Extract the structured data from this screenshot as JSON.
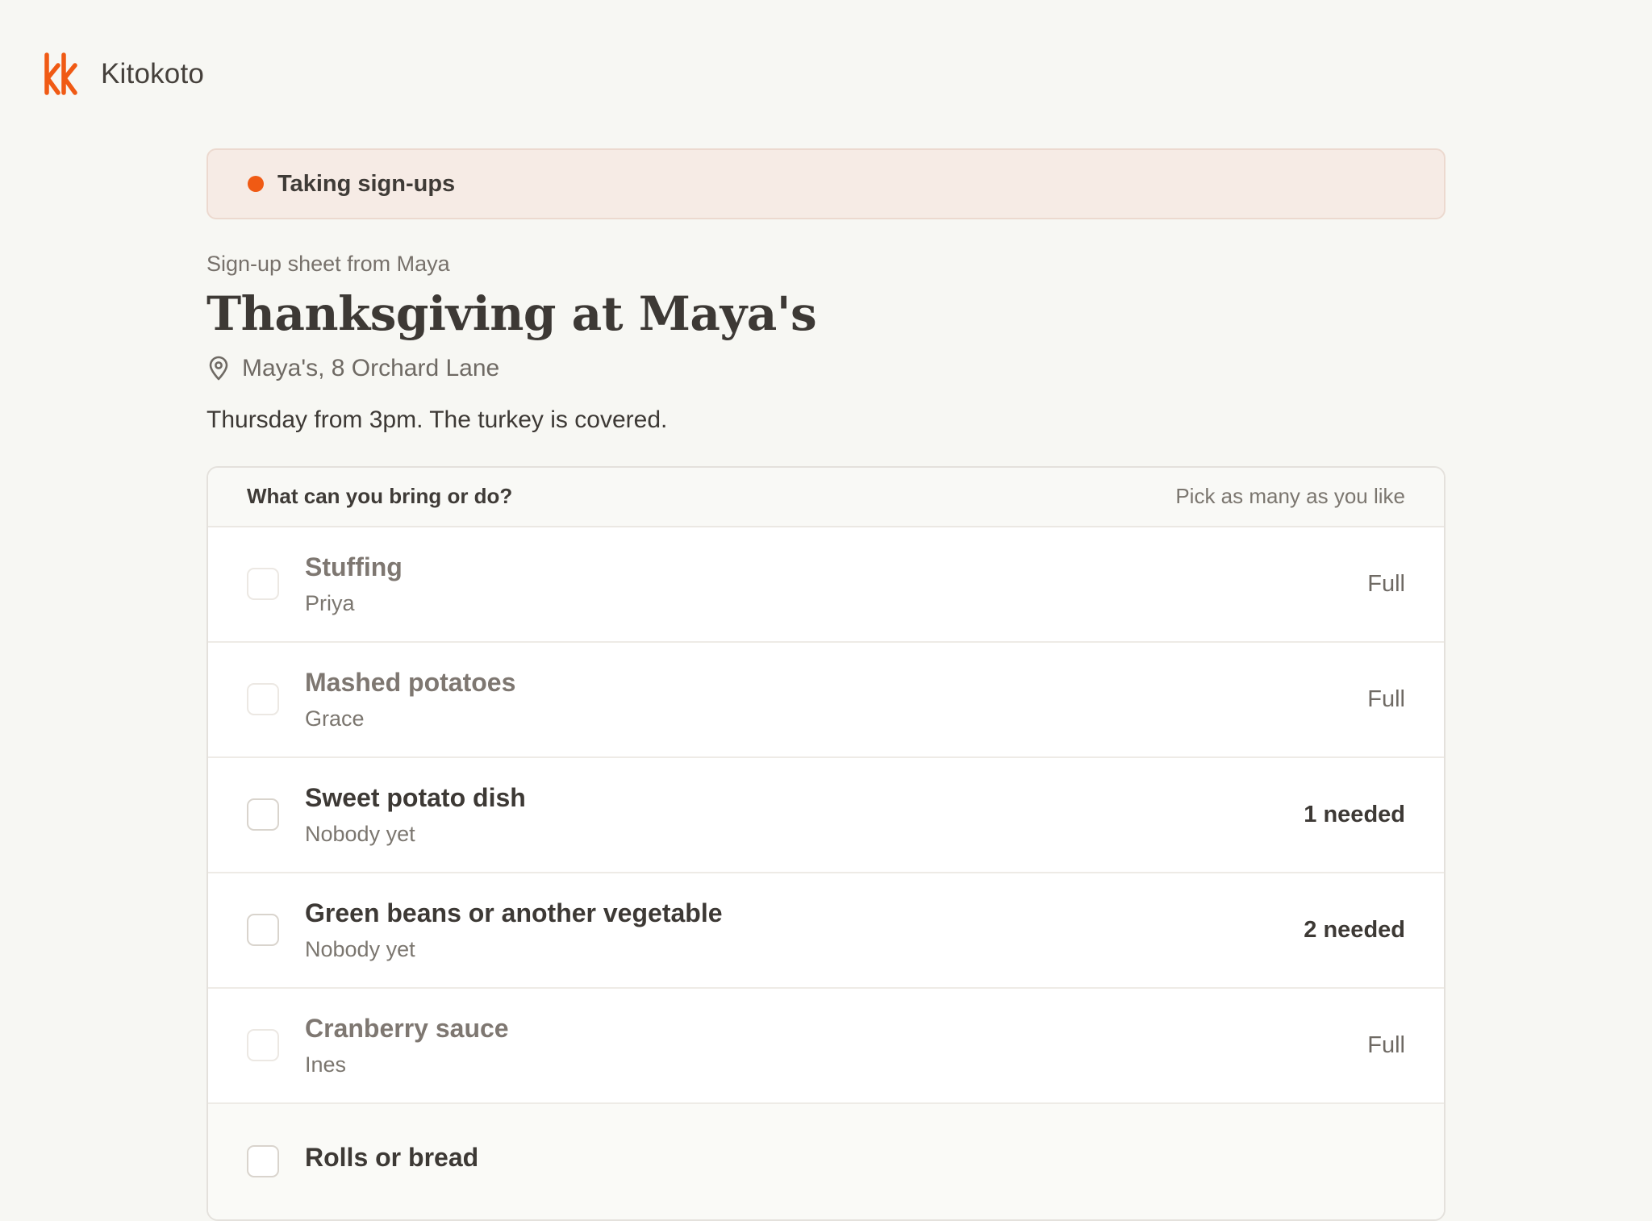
{
  "brand": {
    "name": "Kitokoto",
    "logo_icon": "kk-logo-icon",
    "accent_color": "#f05a14"
  },
  "status": {
    "label": "Taking sign-ups",
    "dot_color": "#f05a14"
  },
  "sheet": {
    "eyebrow": "Sign-up sheet from Maya",
    "title": "Thanksgiving at Maya's",
    "location_icon": "map-pin-icon",
    "location": "Maya's, 8 Orchard Lane",
    "description": "Thursday from 3pm. The turkey is covered."
  },
  "list": {
    "question": "What can you bring or do?",
    "hint": "Pick as many as you like",
    "items": [
      {
        "name": "Stuffing",
        "who": "Priya",
        "status": "Full",
        "checked": false,
        "full": true
      },
      {
        "name": "Mashed potatoes",
        "who": "Grace",
        "status": "Full",
        "checked": false,
        "full": true
      },
      {
        "name": "Sweet potato dish",
        "who": "Nobody yet",
        "status": "1 needed",
        "checked": false,
        "full": false
      },
      {
        "name": "Green beans or another vegetable",
        "who": "Nobody yet",
        "status": "2 needed",
        "checked": false,
        "full": false
      },
      {
        "name": "Cranberry sauce",
        "who": "Ines",
        "status": "Full",
        "checked": false,
        "full": true
      },
      {
        "name": "Rolls or bread",
        "who": "",
        "status": "",
        "checked": false,
        "full": false
      }
    ]
  }
}
